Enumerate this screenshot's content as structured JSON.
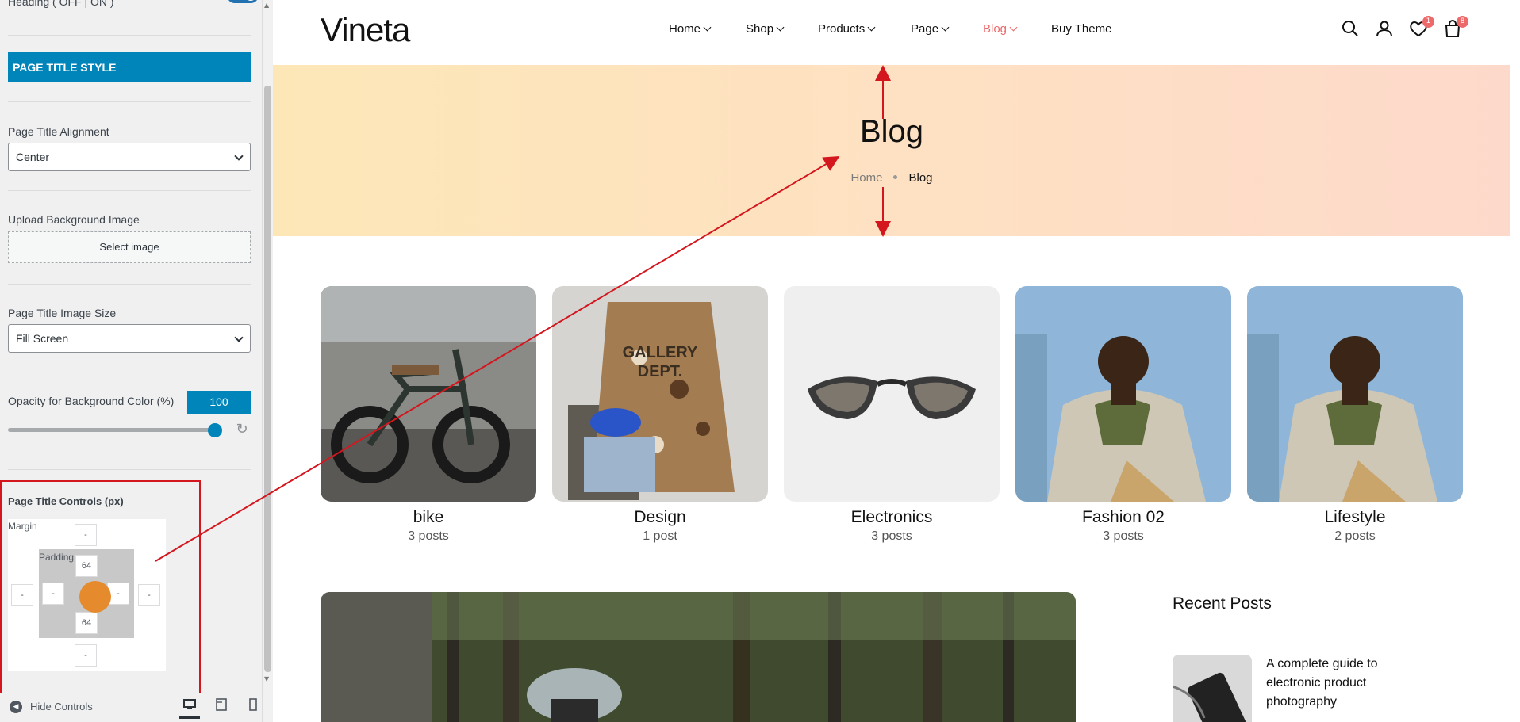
{
  "panel": {
    "heading_toggle_label": "Heading ( OFF | ON )",
    "section_title": "PAGE TITLE STYLE",
    "alignment": {
      "label": "Page Title Alignment",
      "value": "Center"
    },
    "upload": {
      "label": "Upload Background Image",
      "button": "Select image"
    },
    "image_size": {
      "label": "Page Title Image Size",
      "value": "Fill Screen"
    },
    "opacity": {
      "label": "Opacity for Background Color (%)",
      "value": "100",
      "level_percent": 100
    },
    "controls": {
      "label": "Page Title Controls (px)",
      "margin_label": "Margin",
      "padding_label": "Padding",
      "margin": {
        "top": "-",
        "right": "-",
        "bottom": "-",
        "left": "-"
      },
      "padding": {
        "top": "64",
        "right": "-",
        "bottom": "64",
        "left": "-"
      }
    },
    "footer": {
      "hide_controls": "Hide Controls"
    }
  },
  "site": {
    "logo": "Vineta",
    "nav": [
      {
        "label": "Home",
        "dropdown": true
      },
      {
        "label": "Shop",
        "dropdown": true
      },
      {
        "label": "Products",
        "dropdown": true
      },
      {
        "label": "Page",
        "dropdown": true
      },
      {
        "label": "Blog",
        "dropdown": true,
        "active": true
      },
      {
        "label": "Buy Theme",
        "dropdown": false
      }
    ],
    "wishlist_count": "1",
    "cart_count": "8",
    "hero": {
      "title": "Blog",
      "crumb_home": "Home",
      "crumb_current": "Blog"
    },
    "categories": [
      {
        "name": "bike",
        "count": "3 posts"
      },
      {
        "name": "Design",
        "count": "1 post"
      },
      {
        "name": "Electronics",
        "count": "3 posts"
      },
      {
        "name": "Fashion 02",
        "count": "3 posts"
      },
      {
        "name": "Lifestyle",
        "count": "2 posts"
      }
    ],
    "recent": {
      "title": "Recent Posts",
      "post_title": "A complete guide to electronic product photography"
    }
  },
  "colors": {
    "accent": "#0085ba",
    "active_nav": "#ee6a6a",
    "annotation": "#d4161e"
  }
}
